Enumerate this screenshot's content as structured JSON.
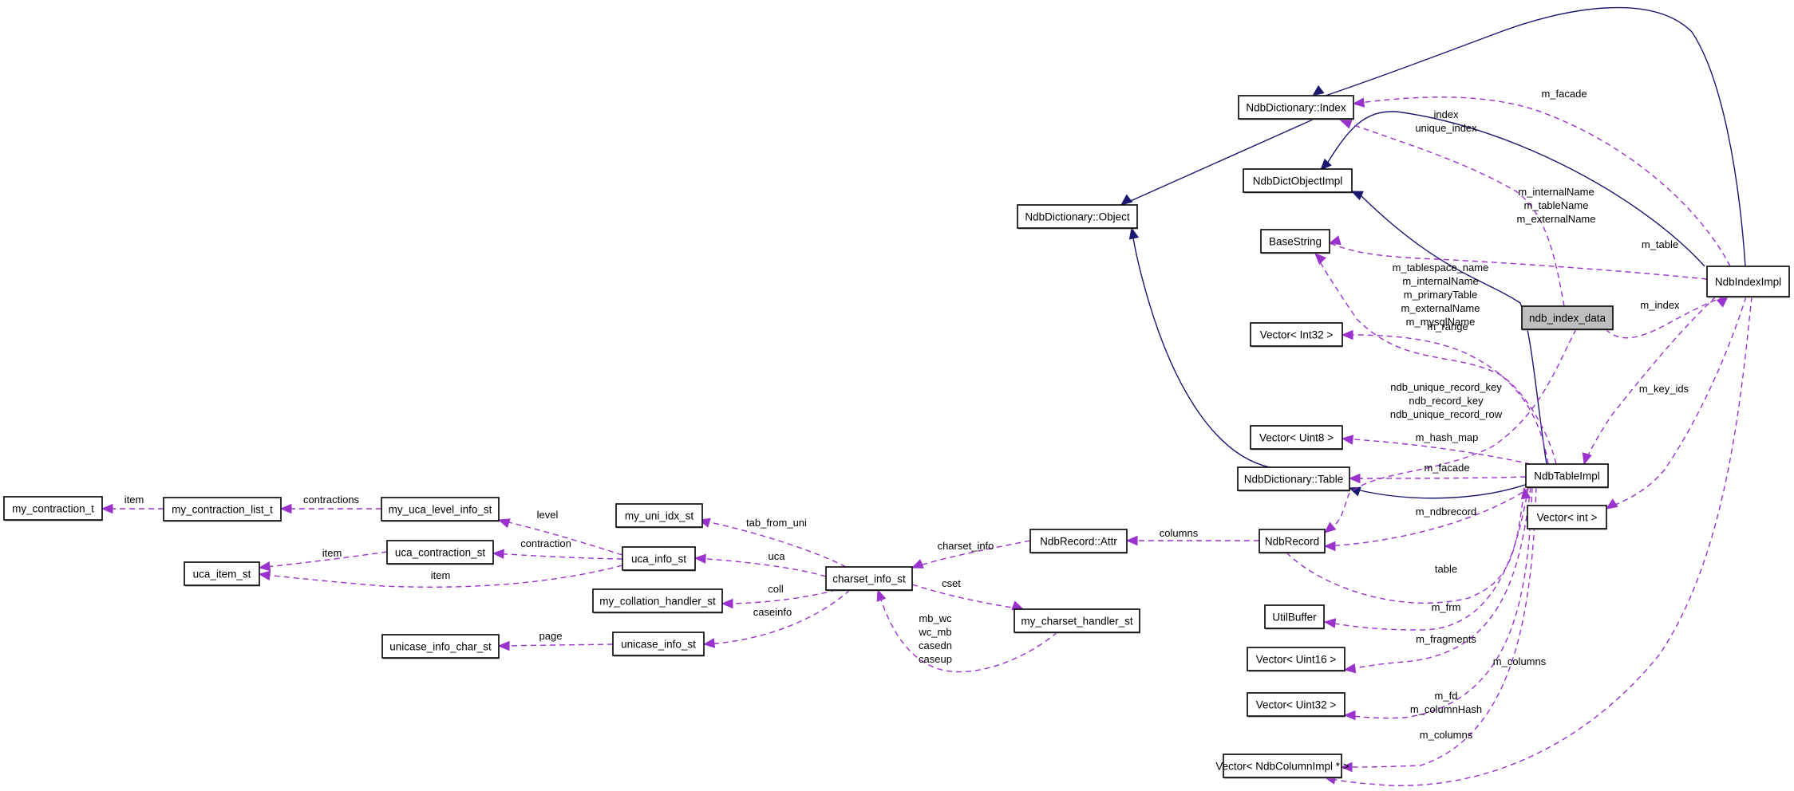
{
  "diagram": {
    "type": "collaboration-graph",
    "focus_node": "ndb_index_data",
    "colors": {
      "inheritance_edge": "#191970",
      "usage_edge": "#9a32cd",
      "focus_fill": "#bfbfbf",
      "node_fill": "#ffffff",
      "node_border": "#000000"
    },
    "nodes": [
      {
        "id": "NdbDictionary_Index",
        "label": "NdbDictionary::Index"
      },
      {
        "id": "NdbDictObjectImpl",
        "label": "NdbDictObjectImpl"
      },
      {
        "id": "NdbDictionary_Object",
        "label": "NdbDictionary::Object"
      },
      {
        "id": "BaseString",
        "label": "BaseString"
      },
      {
        "id": "NdbIndexImpl",
        "label": "NdbIndexImpl"
      },
      {
        "id": "ndb_index_data",
        "label": "ndb_index_data"
      },
      {
        "id": "Vector_Int32",
        "label": "Vector< Int32 >"
      },
      {
        "id": "Vector_Uint8",
        "label": "Vector< Uint8 >"
      },
      {
        "id": "NdbDictionary_Table",
        "label": "NdbDictionary::Table"
      },
      {
        "id": "NdbTableImpl",
        "label": "NdbTableImpl"
      },
      {
        "id": "Vector_int",
        "label": "Vector< int >"
      },
      {
        "id": "NdbRecord",
        "label": "NdbRecord"
      },
      {
        "id": "NdbRecord_Attr",
        "label": "NdbRecord::Attr"
      },
      {
        "id": "UtilBuffer",
        "label": "UtilBuffer"
      },
      {
        "id": "Vector_Uint16",
        "label": "Vector< Uint16 >"
      },
      {
        "id": "Vector_Uint32",
        "label": "Vector< Uint32 >"
      },
      {
        "id": "Vector_NdbColumnImpl",
        "label": "Vector< NdbColumnImpl * >"
      },
      {
        "id": "charset_info_st",
        "label": "charset_info_st"
      },
      {
        "id": "my_charset_handler_st",
        "label": "my_charset_handler_st"
      },
      {
        "id": "my_uni_idx_st",
        "label": "my_uni_idx_st"
      },
      {
        "id": "uca_info_st",
        "label": "uca_info_st"
      },
      {
        "id": "my_collation_handler_st",
        "label": "my_collation_handler_st"
      },
      {
        "id": "unicase_info_st",
        "label": "unicase_info_st"
      },
      {
        "id": "my_uca_level_info_st",
        "label": "my_uca_level_info_st"
      },
      {
        "id": "uca_contraction_st",
        "label": "uca_contraction_st"
      },
      {
        "id": "my_contraction_list_t",
        "label": "my_contraction_list_t"
      },
      {
        "id": "my_contraction_t",
        "label": "my_contraction_t"
      },
      {
        "id": "uca_item_st",
        "label": "uca_item_st"
      },
      {
        "id": "unicase_info_char_st",
        "label": "unicase_info_char_st"
      }
    ],
    "edges": [
      {
        "from": "NdbIndexImpl",
        "to": "NdbDictionary_Index",
        "kind": "inherit",
        "labels": []
      },
      {
        "from": "NdbDictionary_Index",
        "to": "NdbDictionary_Object",
        "kind": "inherit",
        "labels": []
      },
      {
        "from": "NdbIndexImpl",
        "to": "NdbDictObjectImpl",
        "kind": "inherit",
        "labels": []
      },
      {
        "from": "NdbTableImpl",
        "to": "NdbDictObjectImpl",
        "kind": "inherit",
        "labels": []
      },
      {
        "from": "NdbDictionary_Table",
        "to": "NdbDictionary_Object",
        "kind": "inherit",
        "labels": []
      },
      {
        "from": "NdbTableImpl",
        "to": "NdbDictionary_Table",
        "kind": "inherit",
        "labels": []
      },
      {
        "from": "NdbIndexImpl",
        "to": "NdbDictionary_Index",
        "kind": "usage",
        "labels": [
          "m_facade"
        ]
      },
      {
        "from": "ndb_index_data",
        "to": "NdbDictionary_Index",
        "kind": "usage",
        "labels": [
          "index",
          "unique_index"
        ]
      },
      {
        "from": "NdbIndexImpl",
        "to": "BaseString",
        "kind": "usage",
        "labels": [
          "m_internalName",
          "m_tableName",
          "m_externalName"
        ]
      },
      {
        "from": "NdbTableImpl",
        "to": "BaseString",
        "kind": "usage",
        "labels": [
          "m_tablespace_name",
          "m_internalName",
          "m_primaryTable",
          "m_externalName",
          "m_mysqlName"
        ]
      },
      {
        "from": "NdbIndexImpl",
        "to": "NdbTableImpl",
        "kind": "usage",
        "labels": [
          "m_table"
        ]
      },
      {
        "from": "ndb_index_data",
        "to": "NdbIndexImpl",
        "kind": "usage",
        "labels": [
          "m_index"
        ]
      },
      {
        "from": "NdbTableImpl",
        "to": "Vector_Int32",
        "kind": "usage",
        "labels": [
          "m_range"
        ]
      },
      {
        "from": "ndb_index_data",
        "to": "NdbRecord",
        "kind": "usage",
        "labels": [
          "ndb_unique_record_key",
          "ndb_record_key",
          "ndb_unique_record_row"
        ]
      },
      {
        "from": "NdbIndexImpl",
        "to": "Vector_int",
        "kind": "usage",
        "labels": [
          "m_key_ids"
        ]
      },
      {
        "from": "NdbTableImpl",
        "to": "Vector_Uint8",
        "kind": "usage",
        "labels": [
          "m_hash_map"
        ]
      },
      {
        "from": "NdbTableImpl",
        "to": "NdbDictionary_Table",
        "kind": "usage",
        "labels": [
          "m_facade"
        ]
      },
      {
        "from": "NdbTableImpl",
        "to": "NdbRecord",
        "kind": "usage",
        "labels": [
          "m_ndbrecord"
        ]
      },
      {
        "from": "NdbRecord",
        "to": "NdbRecord_Attr",
        "kind": "usage",
        "labels": [
          "columns"
        ]
      },
      {
        "from": "NdbRecord",
        "to": "NdbTableImpl",
        "kind": "usage",
        "labels": [
          "table"
        ]
      },
      {
        "from": "NdbTableImpl",
        "to": "UtilBuffer",
        "kind": "usage",
        "labels": [
          "m_frm"
        ]
      },
      {
        "from": "NdbTableImpl",
        "to": "Vector_Uint16",
        "kind": "usage",
        "labels": [
          "m_fragments"
        ]
      },
      {
        "from": "NdbTableImpl",
        "to": "Vector_Uint32",
        "kind": "usage",
        "labels": [
          "m_fd",
          "m_columnHash"
        ]
      },
      {
        "from": "NdbTableImpl",
        "to": "Vector_NdbColumnImpl",
        "kind": "usage",
        "labels": [
          "m_columns"
        ]
      },
      {
        "from": "NdbIndexImpl",
        "to": "Vector_NdbColumnImpl",
        "kind": "usage",
        "labels": [
          "m_columns"
        ]
      },
      {
        "from": "NdbRecord_Attr",
        "to": "charset_info_st",
        "kind": "usage",
        "labels": [
          "charset_info"
        ]
      },
      {
        "from": "charset_info_st",
        "to": "my_uni_idx_st",
        "kind": "usage",
        "labels": [
          "tab_from_uni"
        ]
      },
      {
        "from": "charset_info_st",
        "to": "uca_info_st",
        "kind": "usage",
        "labels": [
          "uca"
        ]
      },
      {
        "from": "charset_info_st",
        "to": "my_collation_handler_st",
        "kind": "usage",
        "labels": [
          "coll"
        ]
      },
      {
        "from": "charset_info_st",
        "to": "unicase_info_st",
        "kind": "usage",
        "labels": [
          "caseinfo"
        ]
      },
      {
        "from": "charset_info_st",
        "to": "my_charset_handler_st",
        "kind": "usage",
        "labels": [
          "cset"
        ]
      },
      {
        "from": "my_charset_handler_st",
        "to": "charset_info_st",
        "kind": "usage",
        "labels": [
          "mb_wc",
          "wc_mb",
          "casedn",
          "caseup"
        ]
      },
      {
        "from": "uca_info_st",
        "to": "my_uca_level_info_st",
        "kind": "usage",
        "labels": [
          "level"
        ]
      },
      {
        "from": "uca_info_st",
        "to": "uca_contraction_st",
        "kind": "usage",
        "labels": [
          "contraction"
        ]
      },
      {
        "from": "uca_info_st",
        "to": "uca_item_st",
        "kind": "usage",
        "labels": [
          "item"
        ]
      },
      {
        "from": "uca_contraction_st",
        "to": "uca_item_st",
        "kind": "usage",
        "labels": [
          "item"
        ]
      },
      {
        "from": "my_uca_level_info_st",
        "to": "my_contraction_list_t",
        "kind": "usage",
        "labels": [
          "contractions"
        ]
      },
      {
        "from": "my_contraction_list_t",
        "to": "my_contraction_t",
        "kind": "usage",
        "labels": [
          "item"
        ]
      },
      {
        "from": "unicase_info_st",
        "to": "unicase_info_char_st",
        "kind": "usage",
        "labels": [
          "page"
        ]
      }
    ]
  }
}
